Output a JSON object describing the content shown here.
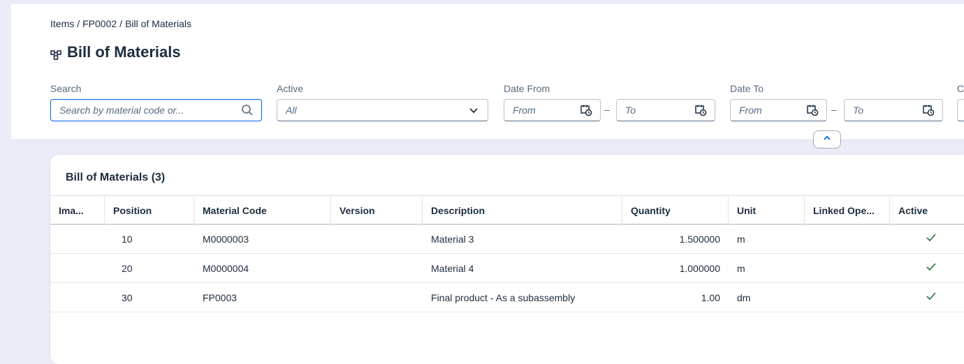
{
  "breadcrumb": [
    "Items",
    "FP0002",
    "Bill of Materials"
  ],
  "page_title": "Bill of Materials",
  "filters": {
    "search_label": "Search",
    "search_placeholder": "Search by material code or...",
    "active_label": "Active",
    "active_value": "All",
    "date_from_label": "Date From",
    "date_to_label": "Date To",
    "from_placeholder": "From",
    "to_placeholder": "To",
    "range_dash": "–",
    "extra_label": "C"
  },
  "table": {
    "title": "Bill of Materials (3)",
    "columns": [
      "Ima...",
      "Position",
      "Material Code",
      "Version",
      "Description",
      "Quantity",
      "Unit",
      "Linked Ope...",
      "Active"
    ],
    "rows": [
      {
        "position": "10",
        "material_code": "M0000003",
        "version": "",
        "description": "Material 3",
        "quantity": "1.500000",
        "unit": "m",
        "linked": "",
        "active": true
      },
      {
        "position": "20",
        "material_code": "M0000004",
        "version": "",
        "description": "Material 4",
        "quantity": "1.000000",
        "unit": "m",
        "linked": "",
        "active": true
      },
      {
        "position": "30",
        "material_code": "FP0003",
        "version": "",
        "description": "Final product - As a subassembly",
        "quantity": "1.00",
        "unit": "dm",
        "linked": "",
        "active": true
      }
    ]
  },
  "colors": {
    "accent": "#0064d9",
    "check": "#256f3a",
    "page_bg": "#eaedf7"
  }
}
